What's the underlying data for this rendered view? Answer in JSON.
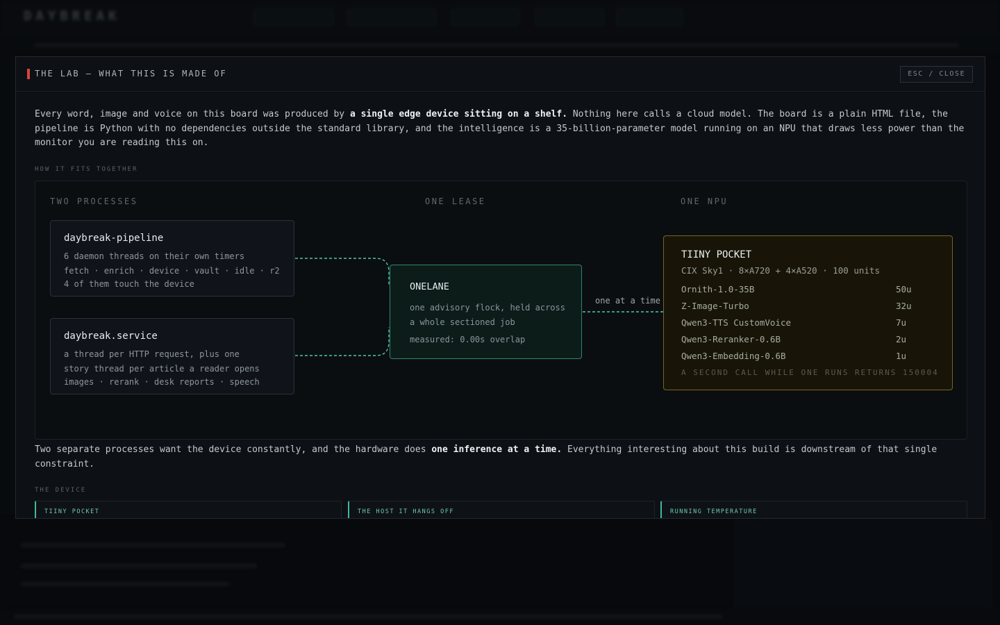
{
  "modal": {
    "title": "THE LAB — WHAT THIS IS MADE OF",
    "close_label": "ESC / CLOSE",
    "intro": {
      "p1": "Every word, image and voice on this board was produced by ",
      "b1": "a single edge device sitting on a shelf.",
      "p2": " Nothing here calls a cloud model. The board is a plain HTML file, the pipeline is Python with no dependencies outside the standard library, and the intelligence is a 35-billion-parameter model running on an NPU that draws less power than the monitor you are reading this on."
    },
    "how_label": "HOW IT FITS TOGETHER",
    "columns": {
      "processes": "TWO PROCESSES",
      "lease": "ONE LEASE",
      "npu": "ONE NPU"
    },
    "pipeline": {
      "name": "daybreak-pipeline",
      "lines": [
        "6 daemon threads on their own timers",
        "fetch · enrich · device · vault · idle · r2",
        "4 of them touch the device"
      ]
    },
    "service": {
      "name": "daybreak.service",
      "lines": [
        "a thread per HTTP request, plus one",
        "story thread per article a reader opens",
        "images · rerank · desk reports · speech"
      ]
    },
    "lease": {
      "name": "ONELANE",
      "lines": [
        "one advisory flock, held across",
        "a whole sectioned job"
      ],
      "measured": "measured: 0.00s overlap"
    },
    "link_label": "one at a time",
    "npu": {
      "name": "TIINY POCKET",
      "spec": "CIX Sky1 · 8×A720 + 4×A520 · 100 units",
      "models": [
        {
          "name": "Ornith-1.0-35B",
          "units": "50u"
        },
        {
          "name": "Z-Image-Turbo",
          "units": "32u"
        },
        {
          "name": "Qwen3-TTS CustomVoice",
          "units": "7u"
        },
        {
          "name": "Qwen3-Reranker-0.6B",
          "units": "2u"
        },
        {
          "name": "Qwen3-Embedding-0.6B",
          "units": "1u"
        }
      ],
      "note": "A SECOND CALL WHILE ONE RUNS RETURNS 150004"
    },
    "outro": {
      "p1": "Two separate processes want the device constantly, and the hardware does ",
      "b1": "one inference at a time.",
      "p2": " Everything interesting about this build is downstream of that single constraint."
    },
    "device_label": "THE DEVICE",
    "cards": [
      "TIINY POCKET",
      "THE HOST IT HANGS OFF",
      "RUNNING TEMPERATURE"
    ]
  },
  "background": {
    "logo": "DAYBREAK"
  },
  "colors": {
    "accent_teal": "#3fb8a3",
    "accent_red": "#d8453a",
    "accent_gold": "#7a6424"
  }
}
